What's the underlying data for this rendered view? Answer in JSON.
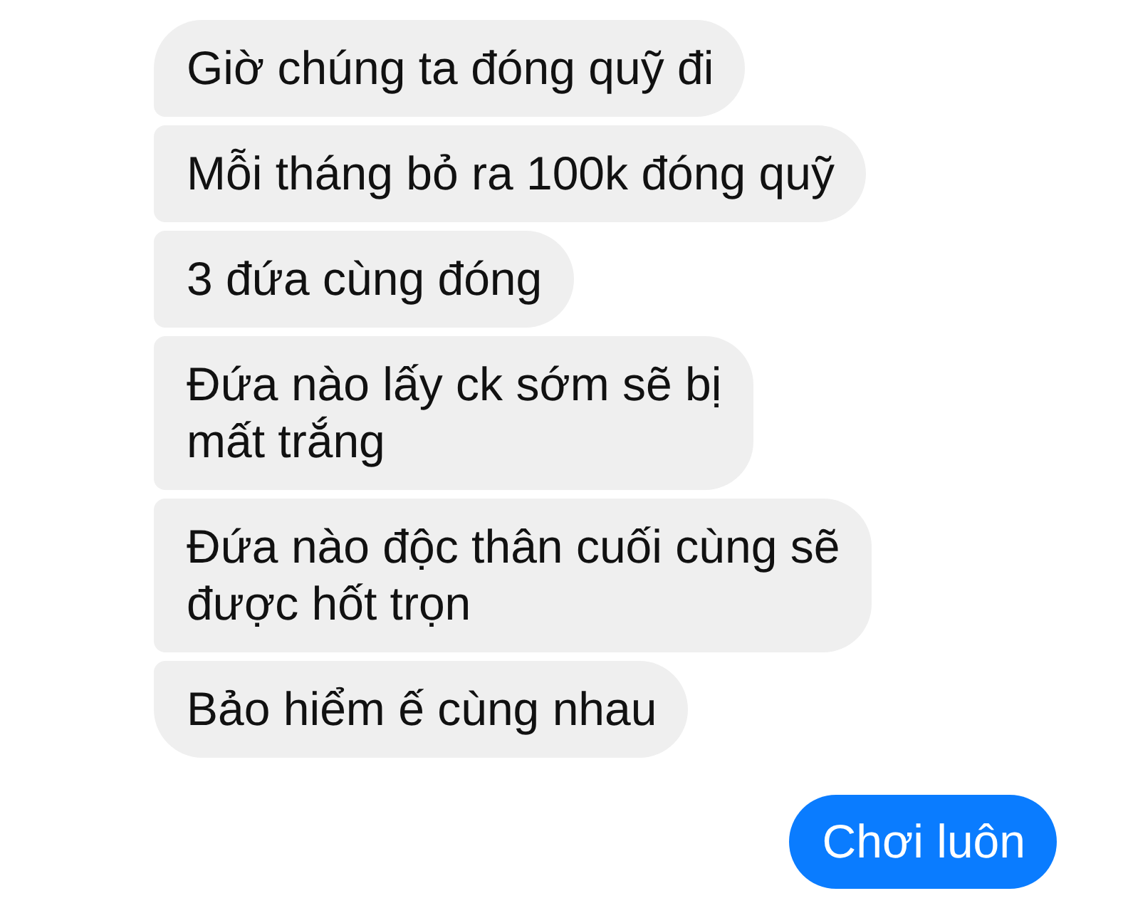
{
  "messages": [
    {
      "kind": "received",
      "text": "Giờ chúng ta đóng quỹ đi"
    },
    {
      "kind": "received",
      "text": "Mỗi tháng bỏ ra 100k đóng quỹ"
    },
    {
      "kind": "received",
      "text": "3 đứa cùng đóng"
    },
    {
      "kind": "received",
      "text": "Đứa nào lấy ck sớm sẽ bị\nmất trắng"
    },
    {
      "kind": "received",
      "text": "Đứa nào độc thân cuối cùng sẽ\nđược hốt trọn"
    },
    {
      "kind": "received",
      "text": "Bảo hiểm ế cùng nhau"
    },
    {
      "kind": "sent",
      "text": "Chơi luôn"
    }
  ]
}
